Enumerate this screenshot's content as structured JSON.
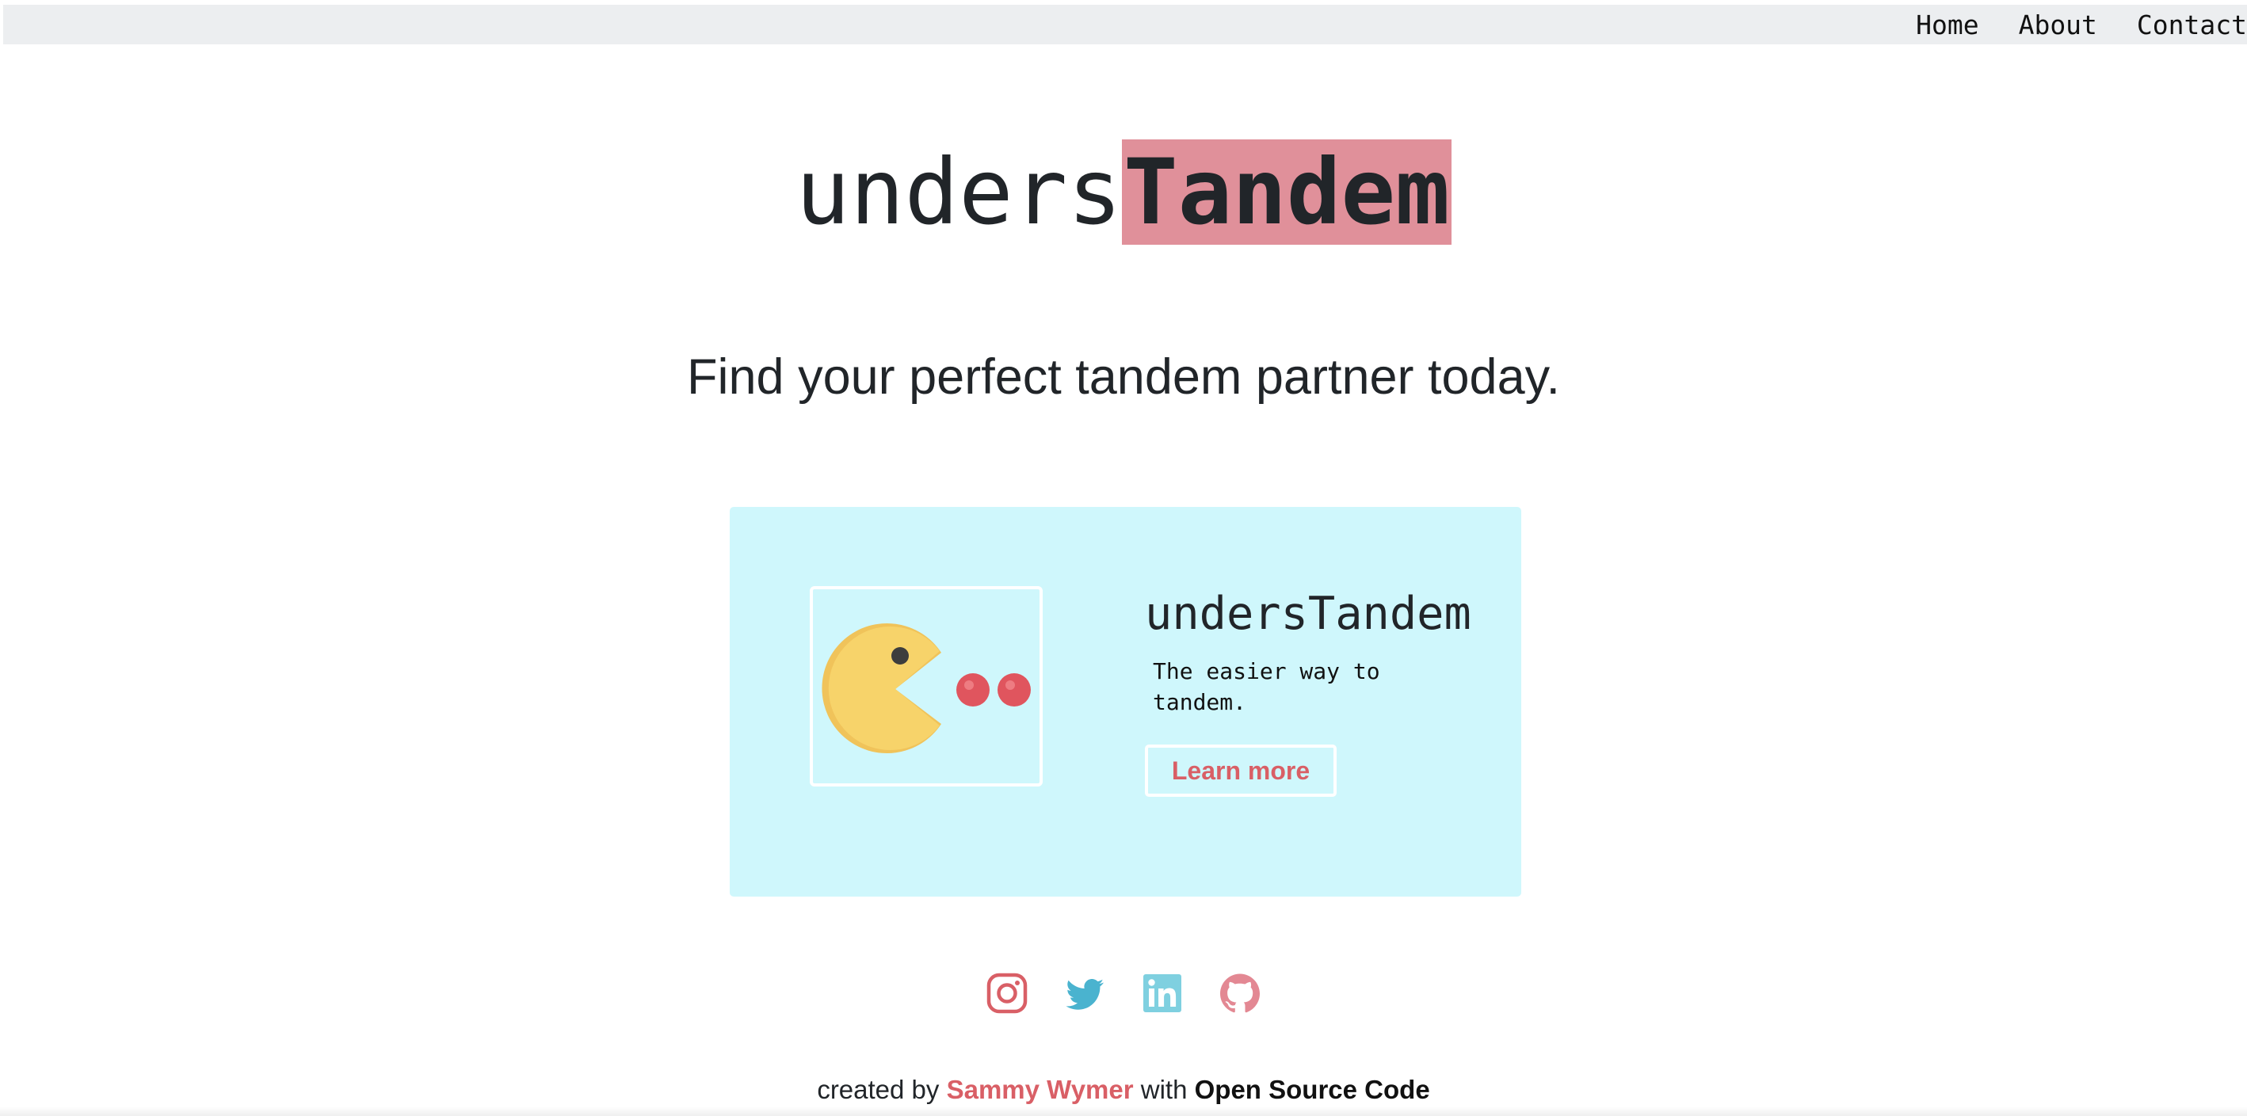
{
  "nav": {
    "links": [
      "Home",
      "About",
      "Contact"
    ]
  },
  "brand": {
    "prefix": "unders",
    "highlight": "Tandem",
    "highlight_color": "#e0909a"
  },
  "tagline": "Find your perfect tandem partner today.",
  "card": {
    "image_icon": "pacman-icon",
    "title": "undersTandem",
    "text": "The easier way to tandem.",
    "button_label": "Learn more",
    "background_color": "#cff7fc"
  },
  "social": {
    "icons": [
      "instagram-icon",
      "twitter-icon",
      "linkedin-icon",
      "github-icon"
    ]
  },
  "footer": {
    "prefix": "created by",
    "author": "Sammy Wymer",
    "middle": "with",
    "source": "Open Source Code",
    "accent_color": "#d95f66"
  }
}
